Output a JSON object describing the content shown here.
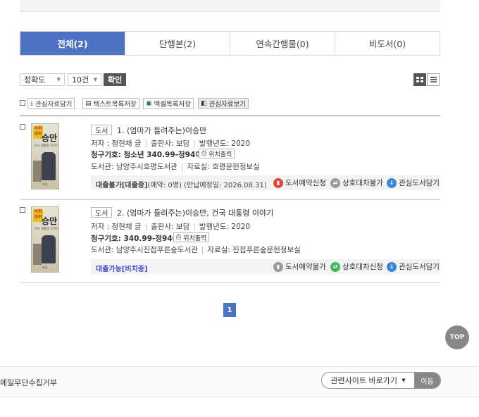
{
  "tabs": [
    {
      "label": "전체(2)",
      "active": true
    },
    {
      "label": "단행본(2)",
      "active": false
    },
    {
      "label": "연속간행물(0)",
      "active": false
    },
    {
      "label": "비도서(0)",
      "active": false
    }
  ],
  "controls": {
    "sort": "정확도",
    "per_page": "10건",
    "confirm": "확인"
  },
  "tools": {
    "cart": "관심자료담기",
    "text_save": "텍스트목록저장",
    "excel_save": "엑셀목록저장",
    "view_interest": "관심자료보기"
  },
  "results": [
    {
      "type": "도서",
      "title": "1. (엄마가 들려주는)이승만",
      "cover_badge": "사회 과학",
      "cover_title": "승만",
      "cover_sub": "건국 대통령 이야기",
      "cover_pub": "보담",
      "author": "저자 : 정현채 글",
      "publisher": "출판사: 보담",
      "year": "발행년도: 2020",
      "call_label": "청구기호:",
      "call_number": "청소년 340.99-정94이",
      "print_loc": "위치출력",
      "library": "도서관: 남양주시호평도서관",
      "room": "자료실: 호평문헌정보실",
      "status": "대출불가[대출중]",
      "status_detail": "(예약: 0명) (반납예정일: 2026.08.31)",
      "reserve": "도서예약신청",
      "ill": "상호대차불가",
      "wish": "관심도서담기"
    },
    {
      "type": "도서",
      "title": "2. (엄마가 들려주는)이승만, 건국 대통령 이야기",
      "cover_badge": "사회 과학",
      "cover_title": "승만",
      "cover_sub": "건국 대통령 이야기",
      "cover_pub": "보담",
      "author": "저자 : 정현채 글",
      "publisher": "출판사: 보담",
      "year": "발행년도: 2020",
      "call_label": "청구기호:",
      "call_number": "340.99-정94이",
      "print_loc": "위치출력",
      "library": "도서관: 남양주시진접푸른숲도서관",
      "room": "자료실: 진접푸른숲문헌정보실",
      "status": "대출가능[비치중]",
      "status_detail": "",
      "reserve": "도서예약불가",
      "ill": "상호대차신청",
      "wish": "관심도서담기"
    }
  ],
  "pagination": {
    "current": "1"
  },
  "top_button": "TOP",
  "footer": {
    "left_text": "메일무단수집거부",
    "related_sites": "관련사이트 바로가기",
    "go": "이동"
  },
  "colors": {
    "accent": "#4d72c2",
    "status_unavailable": "#333333",
    "status_available": "#3a4fd1"
  }
}
